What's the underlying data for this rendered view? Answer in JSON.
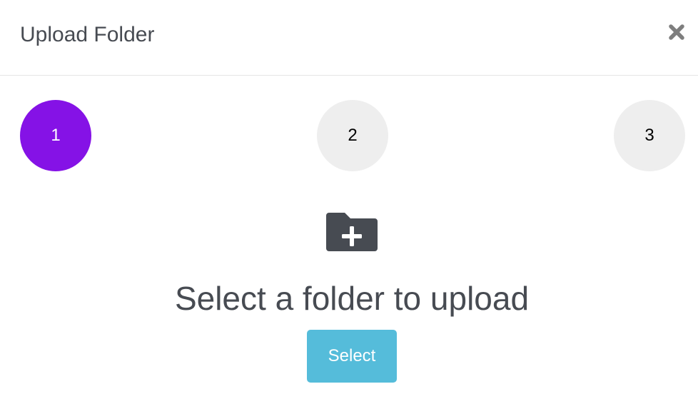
{
  "dialog": {
    "title": "Upload Folder",
    "close_icon": "close-icon"
  },
  "steps": {
    "items": [
      {
        "label": "1",
        "state": "active"
      },
      {
        "label": "2",
        "state": "inactive"
      },
      {
        "label": "3",
        "state": "inactive"
      }
    ],
    "active_color": "#8512e6",
    "inactive_color": "#eeeeee"
  },
  "body": {
    "icon": "folder-plus-icon",
    "prompt": "Select a folder to upload",
    "select_label": "Select",
    "select_color": "#55bcda"
  }
}
